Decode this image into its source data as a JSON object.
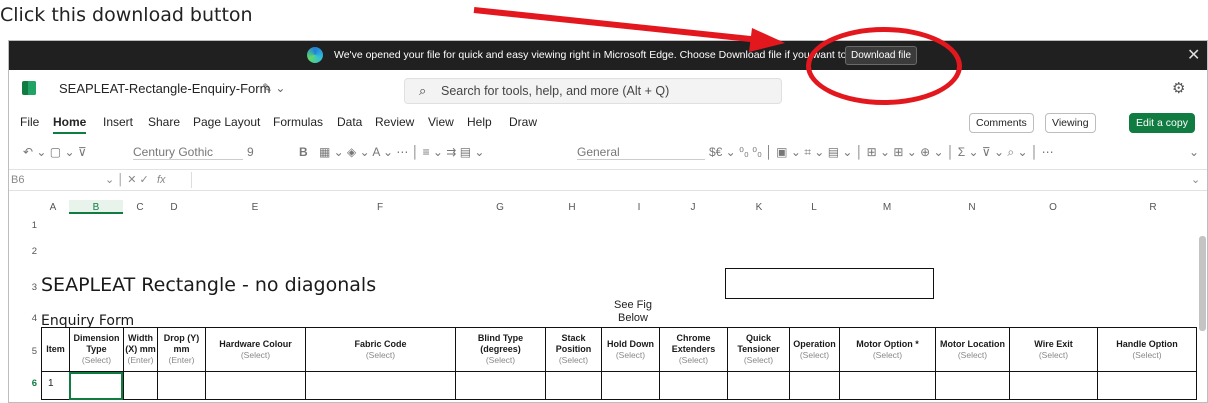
{
  "caption": "Click this download button",
  "infobar": {
    "message": "We've opened your file for quick and easy viewing right in Microsoft Edge. Choose Download file if you want to use it later.",
    "download_label": "Download file",
    "close": "✕"
  },
  "titlebar": {
    "filename": "SEAPLEAT-Rectangle-Enquiry-Form",
    "search_placeholder": "Search for tools, help, and more (Alt + Q)"
  },
  "menu": [
    "File",
    "Home",
    "Insert",
    "Share",
    "Page Layout",
    "Formulas",
    "Data",
    "Review",
    "View",
    "Help",
    "Draw"
  ],
  "ribbon_right": {
    "comments": "Comments",
    "viewing": "Viewing",
    "edit": "Edit a copy"
  },
  "ribbon": {
    "font": "Century Gothic",
    "size": "9",
    "format": "General"
  },
  "formulabar": {
    "cellref": "B6",
    "fx": "fx"
  },
  "columns": [
    "A",
    "B",
    "C",
    "D",
    "E",
    "F",
    "G",
    "H",
    "I",
    "J",
    "K",
    "L",
    "M",
    "N",
    "O",
    "R"
  ],
  "rows": [
    "1",
    "2",
    "3",
    "4",
    "5",
    "6"
  ],
  "sheet": {
    "title": "SEAPLEAT Rectangle - no diagonals",
    "subtitle": "Enquiry Form",
    "see_fig": "See Fig Below",
    "row6_item": "1"
  },
  "headers": [
    {
      "t": "Item",
      "s": ""
    },
    {
      "t": "Dimension Type",
      "s": "(Select)"
    },
    {
      "t": "Width (X) mm",
      "s": "(Enter)"
    },
    {
      "t": "Drop (Y) mm",
      "s": "(Enter)"
    },
    {
      "t": "Hardware Colour",
      "s": "(Select)"
    },
    {
      "t": "Fabric Code",
      "s": "(Select)"
    },
    {
      "t": "Blind Type (degrees)",
      "s": "(Select)"
    },
    {
      "t": "Stack Position",
      "s": "(Select)"
    },
    {
      "t": "Hold Down",
      "s": "(Select)"
    },
    {
      "t": "Chrome Extenders",
      "s": "(Select)"
    },
    {
      "t": "Quick Tensioner",
      "s": "(Select)"
    },
    {
      "t": "Operation",
      "s": "(Select)"
    },
    {
      "t": "Motor Option *",
      "s": "(Select)"
    },
    {
      "t": "Motor Location",
      "s": "(Select)"
    },
    {
      "t": "Wire Exit",
      "s": "(Select)"
    },
    {
      "t": "Handle Option",
      "s": "(Select)"
    }
  ]
}
